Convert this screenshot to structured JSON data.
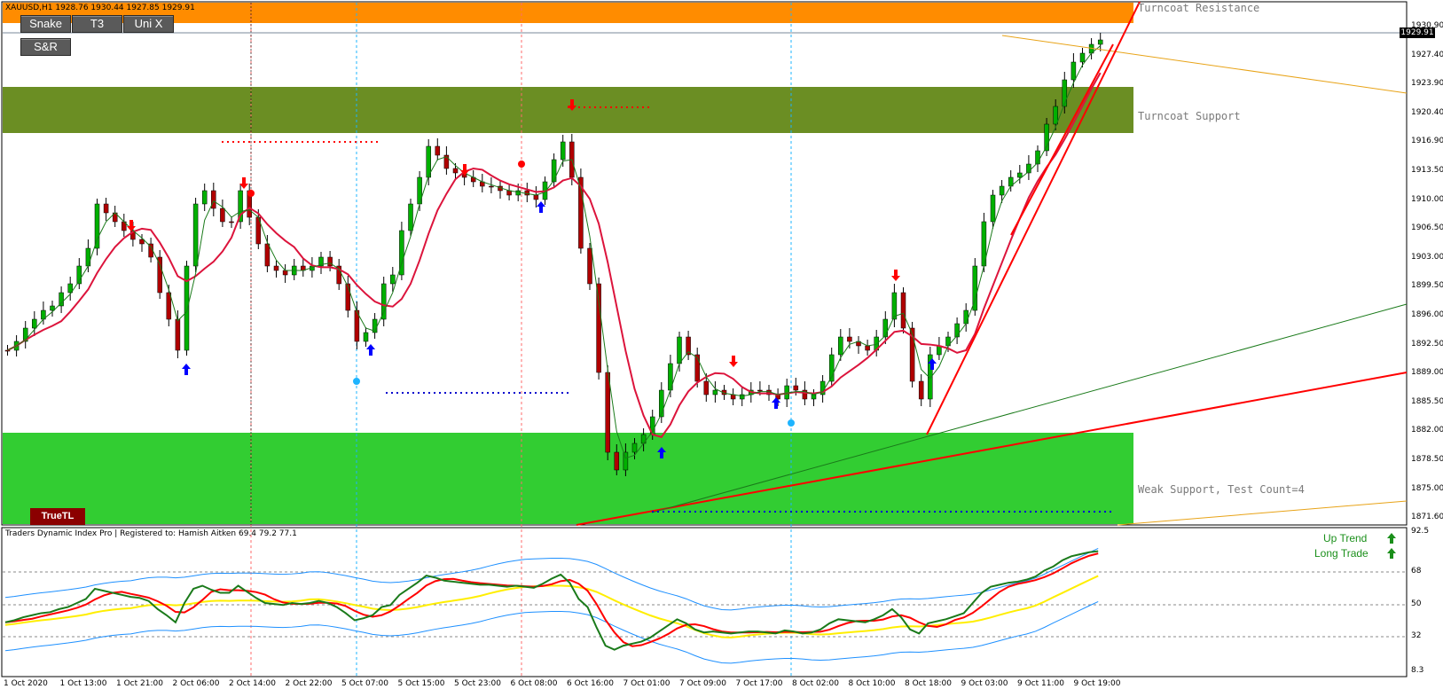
{
  "chart_header": {
    "symbol_info": "XAUUSD,H1  1928.76 1930.44 1927.85 1929.91"
  },
  "buttons": {
    "snake": "Snake",
    "t3": "T3",
    "unix": "Uni X",
    "sr": "S&R"
  },
  "truetl_label": "TrueTL",
  "zones": {
    "resistance_label": "Turncoat Resistance",
    "support_label": "Turncoat Support",
    "weak_support_label": "Weak Support, Test Count=4"
  },
  "price_axis": {
    "current_price": "1929.91",
    "ticks": [
      "1930.90",
      "1927.40",
      "1923.90",
      "1920.40",
      "1916.90",
      "1913.50",
      "1910.00",
      "1906.50",
      "1903.00",
      "1899.50",
      "1896.00",
      "1892.50",
      "1889.00",
      "1885.50",
      "1882.00",
      "1878.50",
      "1875.00",
      "1871.60"
    ]
  },
  "time_axis": {
    "ticks": [
      "1 Oct 2020",
      "1 Oct 13:00",
      "1 Oct 21:00",
      "2 Oct 06:00",
      "2 Oct 14:00",
      "2 Oct 22:00",
      "5 Oct 07:00",
      "5 Oct 15:00",
      "5 Oct 23:00",
      "6 Oct 08:00",
      "6 Oct 16:00",
      "7 Oct 01:00",
      "7 Oct 09:00",
      "7 Oct 17:00",
      "8 Oct 02:00",
      "8 Oct 10:00",
      "8 Oct 18:00",
      "9 Oct 03:00",
      "9 Oct 11:00",
      "9 Oct 19:00"
    ]
  },
  "indicator": {
    "title": "Traders Dynamic Index Pro | Registered to: Hamish Aitken 69.4 79.2 77.1",
    "ticks": [
      "92.5",
      "68",
      "50",
      "32",
      "8.3"
    ],
    "up_trend": "Up Trend",
    "long_trade": "Long Trade"
  },
  "colors": {
    "resistance_zone": "#ff8c00",
    "support_zone": "#6b8e23",
    "weak_support_zone": "#32cd32",
    "bull_candle": "#00b000",
    "bear_candle": "#b00000",
    "ma_red": "#dc143c",
    "rsi_green": "#1a7a1a",
    "signal_red": "#ff0000",
    "middle_yellow": "#ffee00",
    "band_blue": "#1e90ff"
  }
}
